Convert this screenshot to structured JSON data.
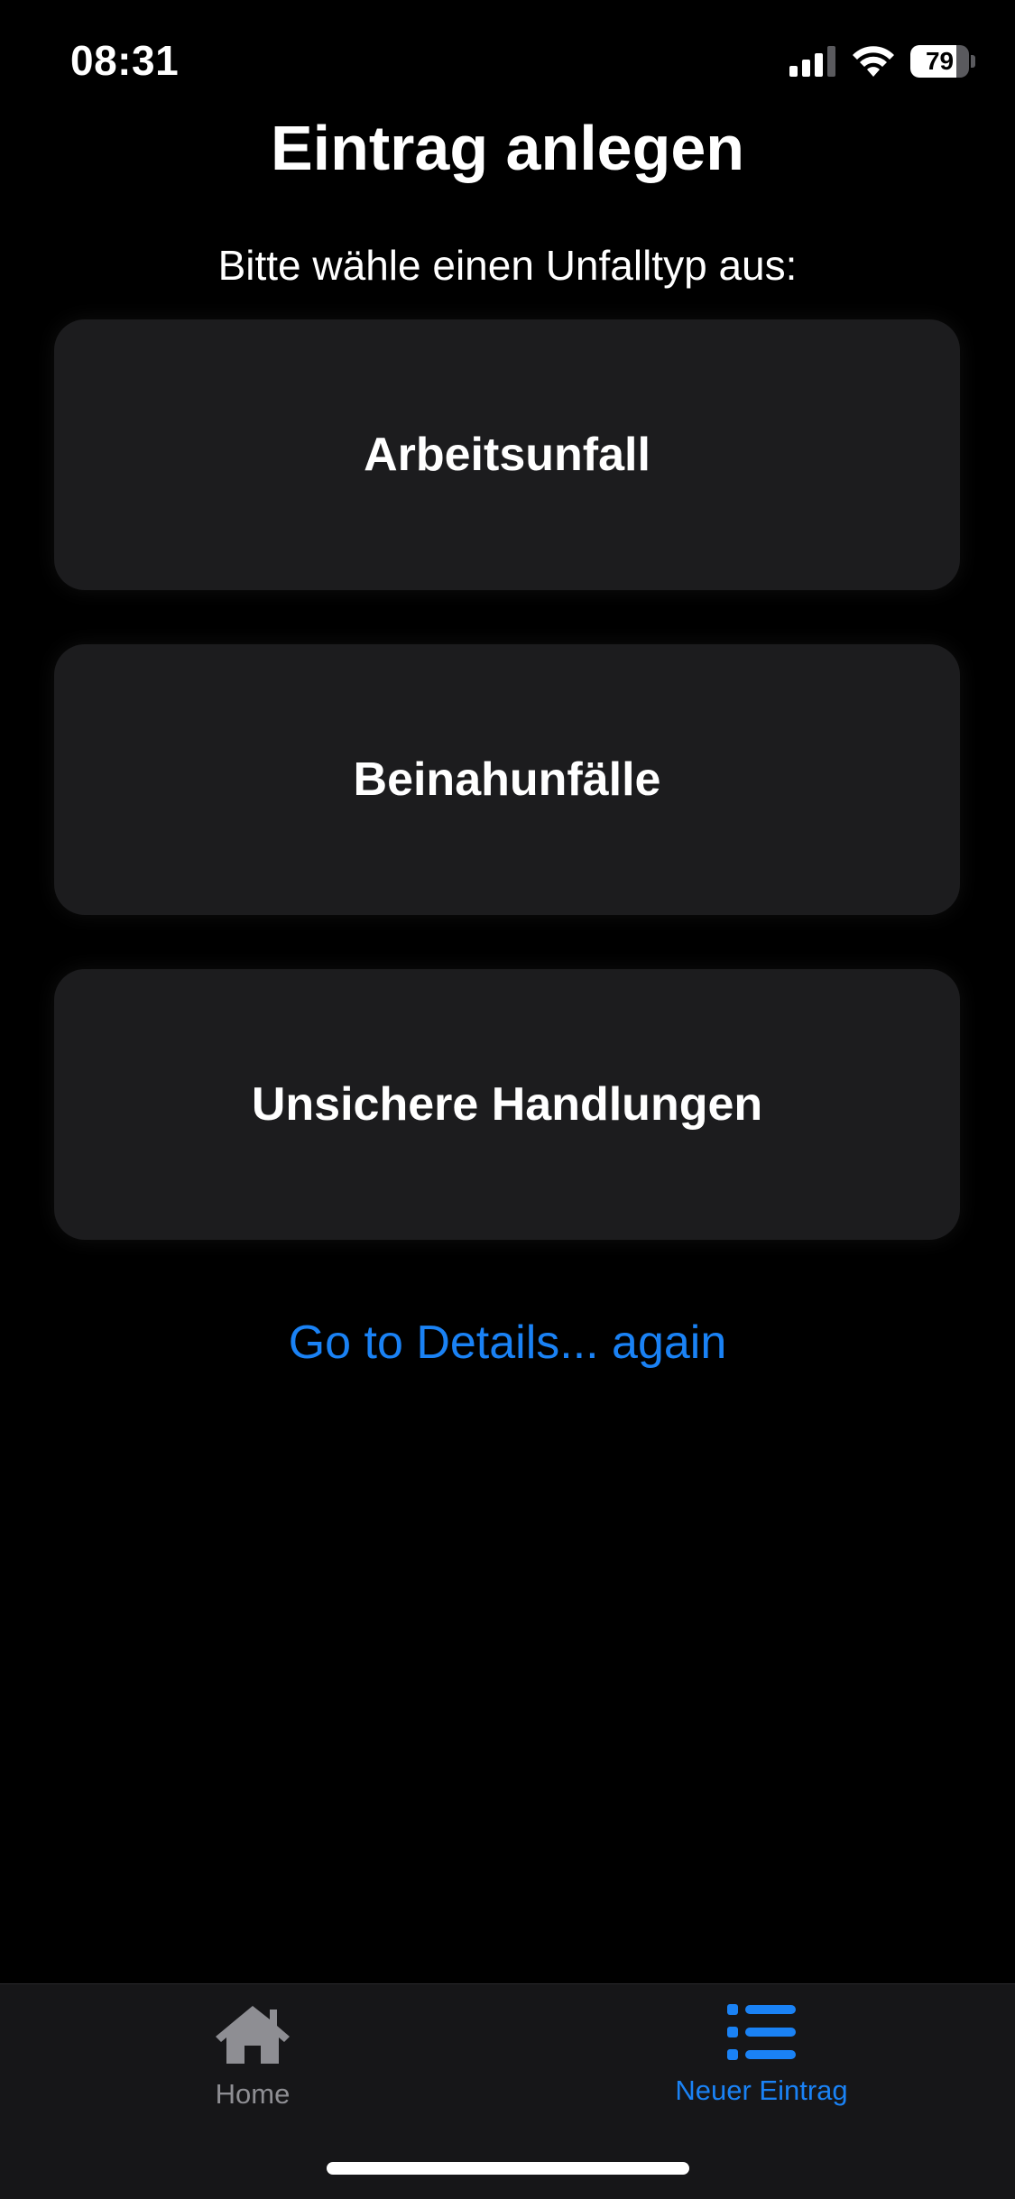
{
  "status_bar": {
    "time": "08:31",
    "battery_level": "79",
    "battery_fraction": 0.79,
    "icons": [
      "signal-icon",
      "wifi-icon",
      "battery-icon"
    ]
  },
  "header": {
    "title": "Eintrag anlegen",
    "subtitle": "Bitte wähle einen Unfalltyp aus:"
  },
  "options": [
    {
      "label": "Arbeitsunfall"
    },
    {
      "label": "Beinahunfälle"
    },
    {
      "label": "Unsichere Handlungen"
    }
  ],
  "details_link": "Go to Details... again",
  "tab_bar": {
    "tabs": [
      {
        "label": "Home",
        "icon": "house-icon",
        "active": false
      },
      {
        "label": "Neuer Eintrag",
        "icon": "list-icon",
        "active": true
      }
    ]
  },
  "colors": {
    "background": "#000000",
    "card": "#1c1c1e",
    "accent": "#1a82f5",
    "inactive_tab": "#8e8e93",
    "tab_bar": "#161618"
  }
}
